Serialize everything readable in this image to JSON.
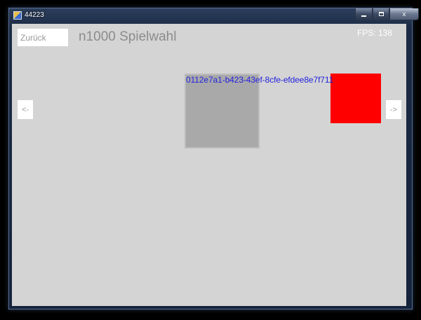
{
  "window": {
    "title": "44223",
    "minimize_label": "",
    "maximize_label": "",
    "close_label": "x"
  },
  "header": {
    "back_label": "Zurück",
    "title": "n1000 Spielwahl",
    "fps": "FPS: 138"
  },
  "nav": {
    "prev_label": "<-",
    "next_label": "->"
  },
  "games": {
    "selected_id": "0112e7a1-b423-43ef-8cfe-efdee8e7f711"
  },
  "colors": {
    "background": "#d4d4d4",
    "tile_gray": "#a9a9a9",
    "tile_red": "#ff0000",
    "id_text": "#2222dd"
  }
}
